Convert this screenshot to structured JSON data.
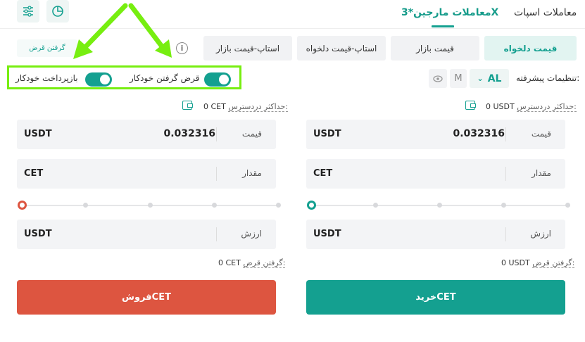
{
  "header": {
    "spot_tab": "معاملات اسپات",
    "margin_tab": "معاملات مارجین*3X",
    "chart_icon": "pie-chart-icon",
    "settings_icon": "sliders-icon"
  },
  "order_tabs": {
    "limit": "قیمت دلخواه",
    "market": "قیمت بازار",
    "stop_limit": "استاپ-قیمت دلخواه",
    "stop_market": "استاپ-قیمت بازار",
    "borrow": "گرفتن قرض"
  },
  "toggles": {
    "auto_borrow": "قرض گرفتن خودکار",
    "auto_repay": "بازپرداخت خودکار"
  },
  "advanced": {
    "label": "تنظیمات پیشرفته:",
    "al": "AL",
    "m": "M"
  },
  "buy": {
    "available_label": "حداکثر دردسترس:",
    "available_value": "0 USDT",
    "price_label": "قیمت",
    "price_value": "0.032316",
    "price_unit": "USDT",
    "amount_label": "مقدار",
    "amount_unit": "CET",
    "total_label": "ارزش",
    "total_unit": "USDT",
    "borrow_label": "گرفتن قرض:",
    "borrow_value": "0 USDT",
    "button": "خریدCET"
  },
  "sell": {
    "available_label": "حداکثر دردسترس:",
    "available_value": "0 CET",
    "price_label": "قیمت",
    "price_value": "0.032316",
    "price_unit": "USDT",
    "amount_label": "مقدار",
    "amount_unit": "CET",
    "total_label": "ارزش",
    "total_unit": "USDT",
    "borrow_label": "گرفتن قرض:",
    "borrow_value": "0 CET",
    "button": "فروشCET"
  },
  "colors": {
    "accent": "#14a090",
    "sell": "#dd5540",
    "annotation": "#77ee10"
  }
}
